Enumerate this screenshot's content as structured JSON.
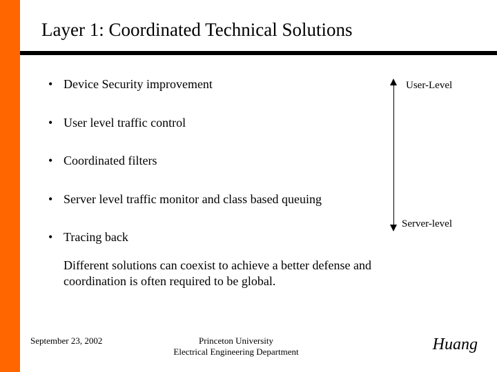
{
  "title": "Layer 1: Coordinated Technical Solutions",
  "bullets": [
    "Device Security improvement",
    "User level traffic control",
    "Coordinated filters",
    "Server level traffic monitor and class based queuing",
    "Tracing back"
  ],
  "arrow": {
    "top_label": "User-Level",
    "bottom_label": "Server-level"
  },
  "paragraph": "Different solutions can coexist to achieve a better defense and coordination is often required to be global.",
  "footer": {
    "date": "September 23, 2002",
    "center_line1": "Princeton University",
    "center_line2": "Electrical Engineering Department",
    "author": "Huang"
  }
}
